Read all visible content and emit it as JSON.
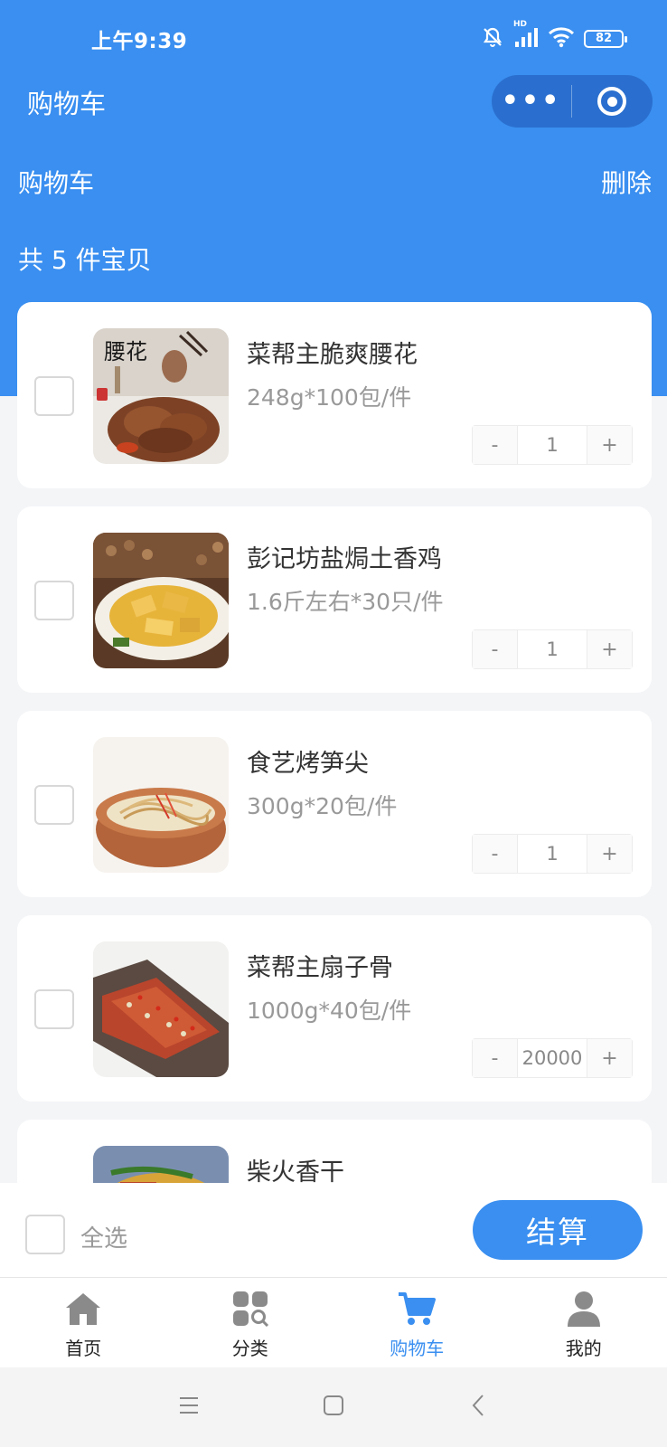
{
  "status_bar": {
    "time": "上午9:39",
    "battery": "82",
    "network": "HD"
  },
  "navbar": {
    "title": "购物车"
  },
  "header": {
    "title": "购物车",
    "delete_label": "删除",
    "count_text": "共 5 件宝贝"
  },
  "cart": {
    "items": [
      {
        "name": "菜帮主脆爽腰花",
        "spec": "248g*100包/件",
        "quantity": "1",
        "minus": "-",
        "plus": "+",
        "image_text": "腰花"
      },
      {
        "name": "彭记坊盐焗土香鸡",
        "spec": "1.6斤左右*30只/件",
        "quantity": "1",
        "minus": "-",
        "plus": "+"
      },
      {
        "name": "食艺烤笋尖",
        "spec": "300g*20包/件",
        "quantity": "1",
        "minus": "-",
        "plus": "+"
      },
      {
        "name": "菜帮主扇子骨",
        "spec": "1000g*40包/件",
        "quantity": "20000",
        "minus": "-",
        "plus": "+"
      },
      {
        "name": "柴火香干",
        "spec": "",
        "quantity": "",
        "minus": "-",
        "plus": "+"
      }
    ]
  },
  "checkout": {
    "select_all_label": "全选",
    "button_label": "结算"
  },
  "tabbar": {
    "tabs": [
      {
        "label": "首页",
        "icon": "home-icon"
      },
      {
        "label": "分类",
        "icon": "category-icon"
      },
      {
        "label": "购物车",
        "icon": "cart-icon",
        "active": true
      },
      {
        "label": "我的",
        "icon": "user-icon"
      }
    ]
  },
  "colors": {
    "accent": "#3a8ff0",
    "capsule": "#2a6fcf",
    "spec_text": "#999999"
  }
}
